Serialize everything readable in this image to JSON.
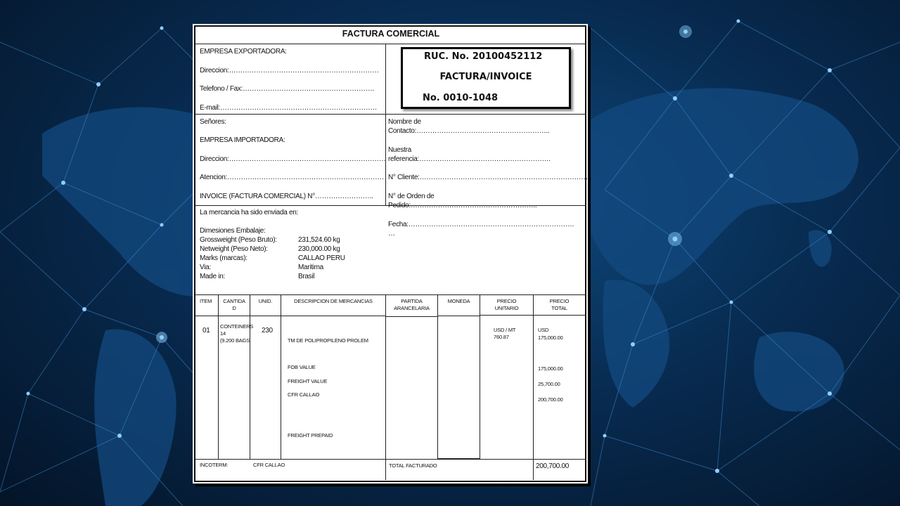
{
  "colors": {
    "background": "#062c52",
    "network_line": "#3d86c7",
    "node": "#8fd0ff",
    "map": "#1a5288"
  },
  "invoice": {
    "title": "FACTURA COMERCIAL",
    "exporter": {
      "empresa": "EMPRESA EXPORTADORA:",
      "direccion": "Direccion:…………………………………………………………",
      "telefono": "Telefono / Fax:………………………………………………….",
      "email": "E-mail:……………………………………………………………"
    },
    "ruc_box": {
      "ruc": "RUC. No. 20100452112",
      "type": "FACTURA/INVOICE",
      "number": "No. 0010-1048"
    },
    "importer": {
      "senores": "Señores:",
      "empresa": "EMPRESA IMPORTADORA:",
      "direccion": "Direccion:……………………………………………………………",
      "atencion": "Atencion:……………………………………………………………",
      "invoice_no": "INVOICE (FACTURA COMERCIAL) N°…………………….."
    },
    "contact": {
      "nombre_1": "Nombre de",
      "nombre_2": "Contacto:…………………………………………………..",
      "referencia_1": "Nuestra",
      "referencia_2": "referencia:………………………………………………….",
      "cliente": "N° Cliente:………………………………………………………………….",
      "orden_1": "N° de Orden de",
      "orden_2": "Pedido:……………………………………………….."
    },
    "shipment": {
      "enviada": "La mercancia ha sido enviada en:",
      "dimensiones": "Dimesiones Embalaje:",
      "rows": [
        {
          "label": "Grossweight (Peso Bruto):",
          "value": "231,524.60 kg"
        },
        {
          "label": "Netweight (Peso Neto):",
          "value": "230,000.00 kg"
        },
        {
          "label": "Marks (marcas):",
          "value": "CALLAO PERU"
        },
        {
          "label": "Via:",
          "value": "Maritima"
        },
        {
          "label": "Made in:",
          "value": "Brasil"
        }
      ],
      "fecha_1": "Fecha:……………………………………………………………….",
      "fecha_2": "…"
    },
    "table": {
      "headers": {
        "item": "ITEM",
        "cantidad_1": "CANTIDA",
        "cantidad_2": "D",
        "unid": "UNID.",
        "descripcion": "DESCRIPCION DE MERCANCIAS",
        "partida_1": "PARTIDA",
        "partida_2": "ARANCELARIA",
        "moneda": "MONEDA",
        "precio_unit_1": "PRECIO",
        "precio_unit_2": "UNITARIO",
        "precio_total_1": "PRECIO",
        "precio_total_2": "TOTAL"
      },
      "item": "01",
      "cantidad_1": "CONTEINERS",
      "cantidad_2": "14",
      "cantidad_3": "(9.200 BAGS",
      "unid": "230",
      "desc_1": "TM DE POLIPROPILENO PROLEM",
      "desc_2": "FOB VALUE",
      "desc_3": "FREIGHT VALUE",
      "desc_4": "CFR CALLAO",
      "desc_5": "FREIGHT PREPAID",
      "precio_unit_1": "USD / MT",
      "precio_unit_2": "760.87",
      "total_1": "USD",
      "total_2": "175,000.00",
      "total_3": "175,000.00",
      "total_4": "25,700.00",
      "total_5": "200,700.00"
    },
    "footer": {
      "incoterm_label": "INCOTERM:",
      "incoterm_value": "CFR CALLAO",
      "total_label": "TOTAL FACTURADO",
      "total_value": "200,700.00"
    }
  }
}
